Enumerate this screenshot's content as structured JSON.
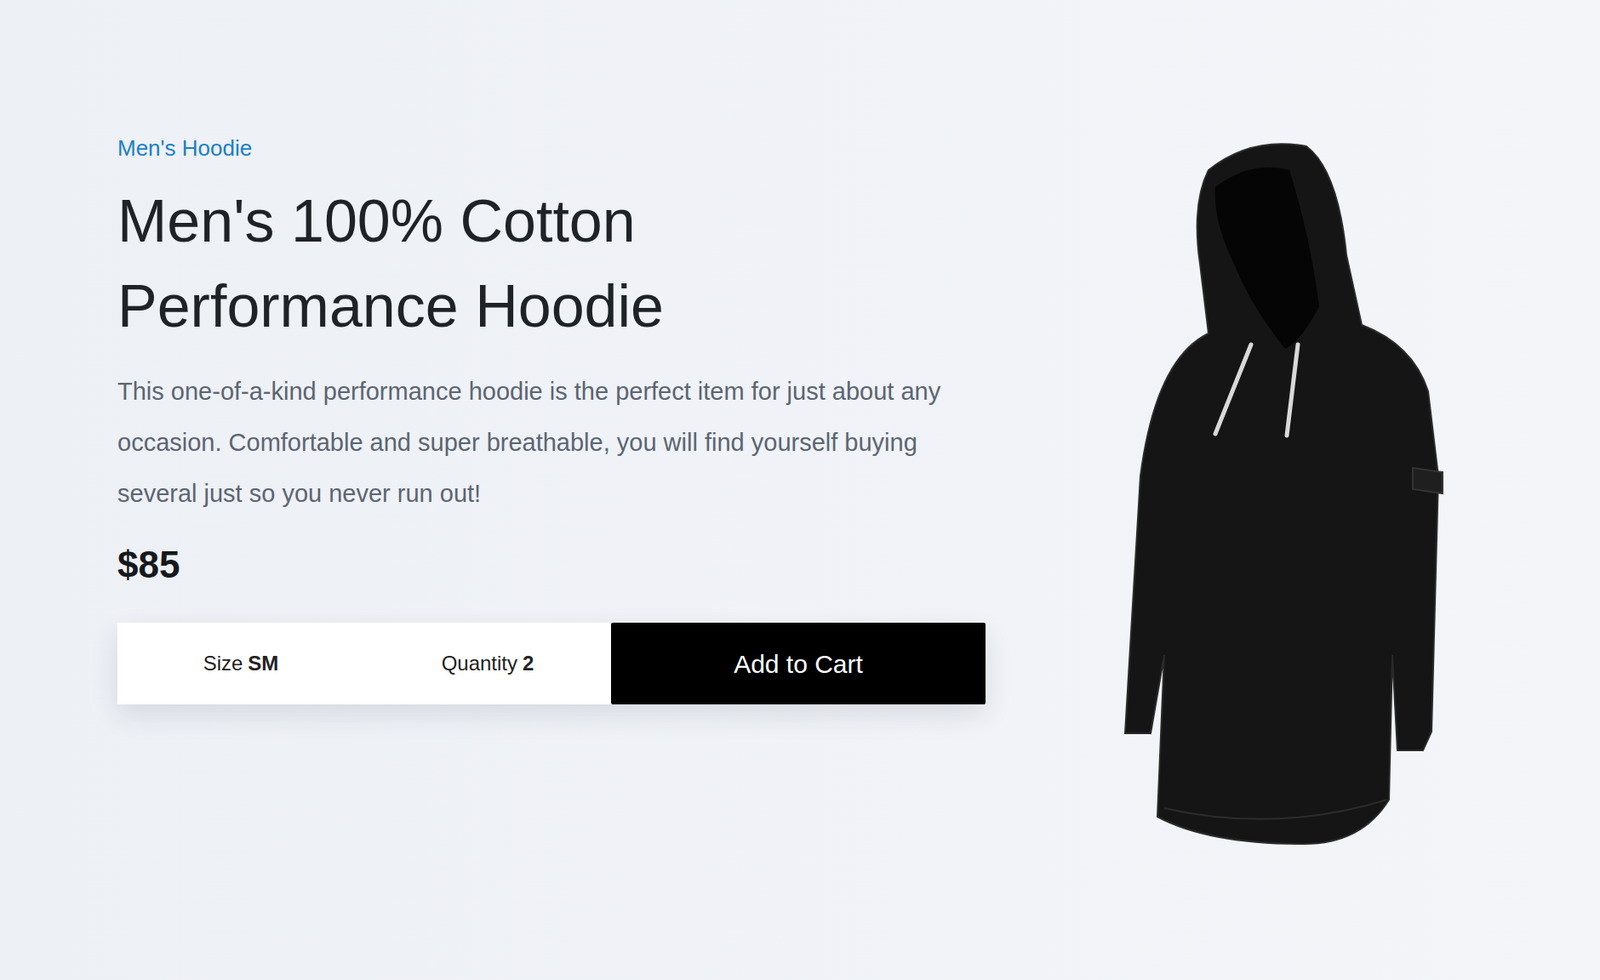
{
  "product": {
    "category": "Men's Hoodie",
    "title": "Men's 100% Cotton Performance Hoodie",
    "description": "This one-of-a-kind performance hoodie is the perfect item for just about any occasion. Comfortable and super breathable, you will find yourself buying several just so you never run out!",
    "price": "$85"
  },
  "options": [
    {
      "label": "Size",
      "value": "SM"
    },
    {
      "label": "Quantity",
      "value": "2"
    }
  ],
  "buttons": [
    "Add to Cart"
  ]
}
